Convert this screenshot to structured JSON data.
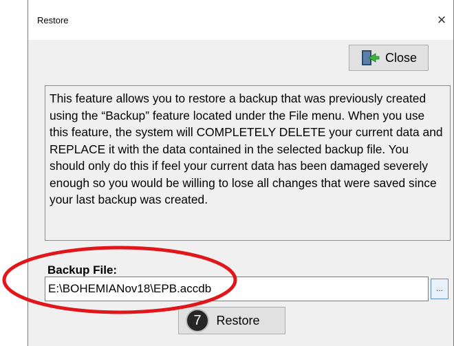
{
  "window": {
    "title": "Restore",
    "close_glyph": "×"
  },
  "toolbar": {
    "close_label": "Close",
    "close_icon": "exit-door-icon"
  },
  "info": {
    "text": "This feature allows you to restore a backup that was previously created using the “Backup” feature located under the File menu. When you use this feature, the system will COMPLETELY DELETE your current data and REPLACE it with the data contained in the selected backup file. You should only do this if feel your current data has been damaged severely enough so you would be willing to lose all changes that were saved since your last backup was created."
  },
  "backup": {
    "label": "Backup File:",
    "value": "E:\\BOHEMIANov18\\EPB.accdb",
    "browse_label": "..."
  },
  "actions": {
    "restore_label": "Restore"
  },
  "annotation": {
    "step_number": "7",
    "highlight_color": "#e0161b"
  }
}
